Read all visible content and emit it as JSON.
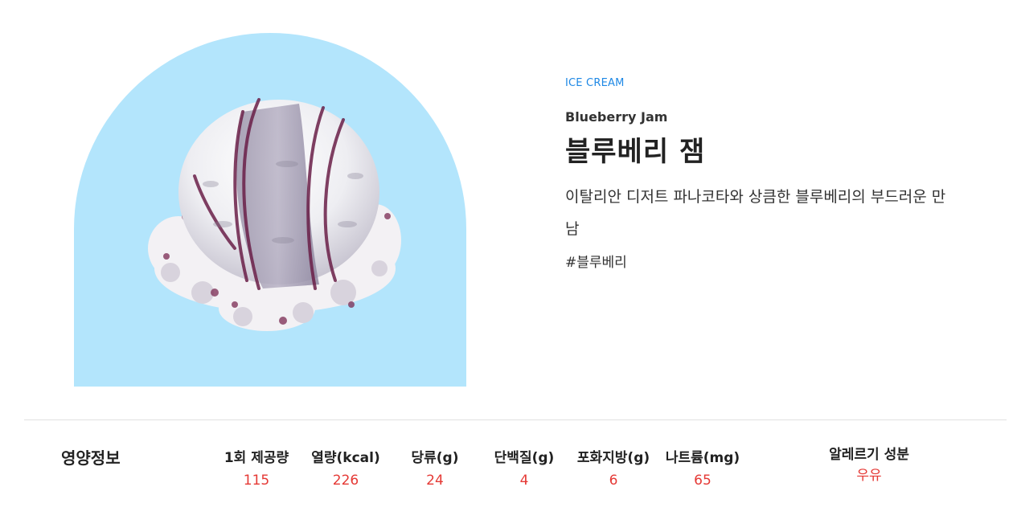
{
  "product": {
    "category": "ICE CREAM",
    "name_en": "Blueberry Jam",
    "name_kr": "블루베리 잼",
    "description": "이탈리안 디저트 파나코타와 상큼한 블루베리의 부드러운 만남",
    "hashtag": "#블루베리",
    "image_icon": "ice-cream-scoop-image",
    "colors": {
      "arch_background": "#b3e5fc",
      "category_text": "#1e88e5",
      "value_text": "#e53935"
    }
  },
  "nutrition": {
    "title": "영양정보",
    "items": [
      {
        "label": "1회 제공량",
        "value": "115"
      },
      {
        "label": "열량(kcal)",
        "value": "226"
      },
      {
        "label": "당류(g)",
        "value": "24"
      },
      {
        "label": "단백질(g)",
        "value": "4"
      },
      {
        "label": "포화지방(g)",
        "value": "6"
      },
      {
        "label": "나트륨(mg)",
        "value": "65"
      }
    ],
    "allergy": {
      "label": "알레르기 성분",
      "value": "우유"
    }
  }
}
